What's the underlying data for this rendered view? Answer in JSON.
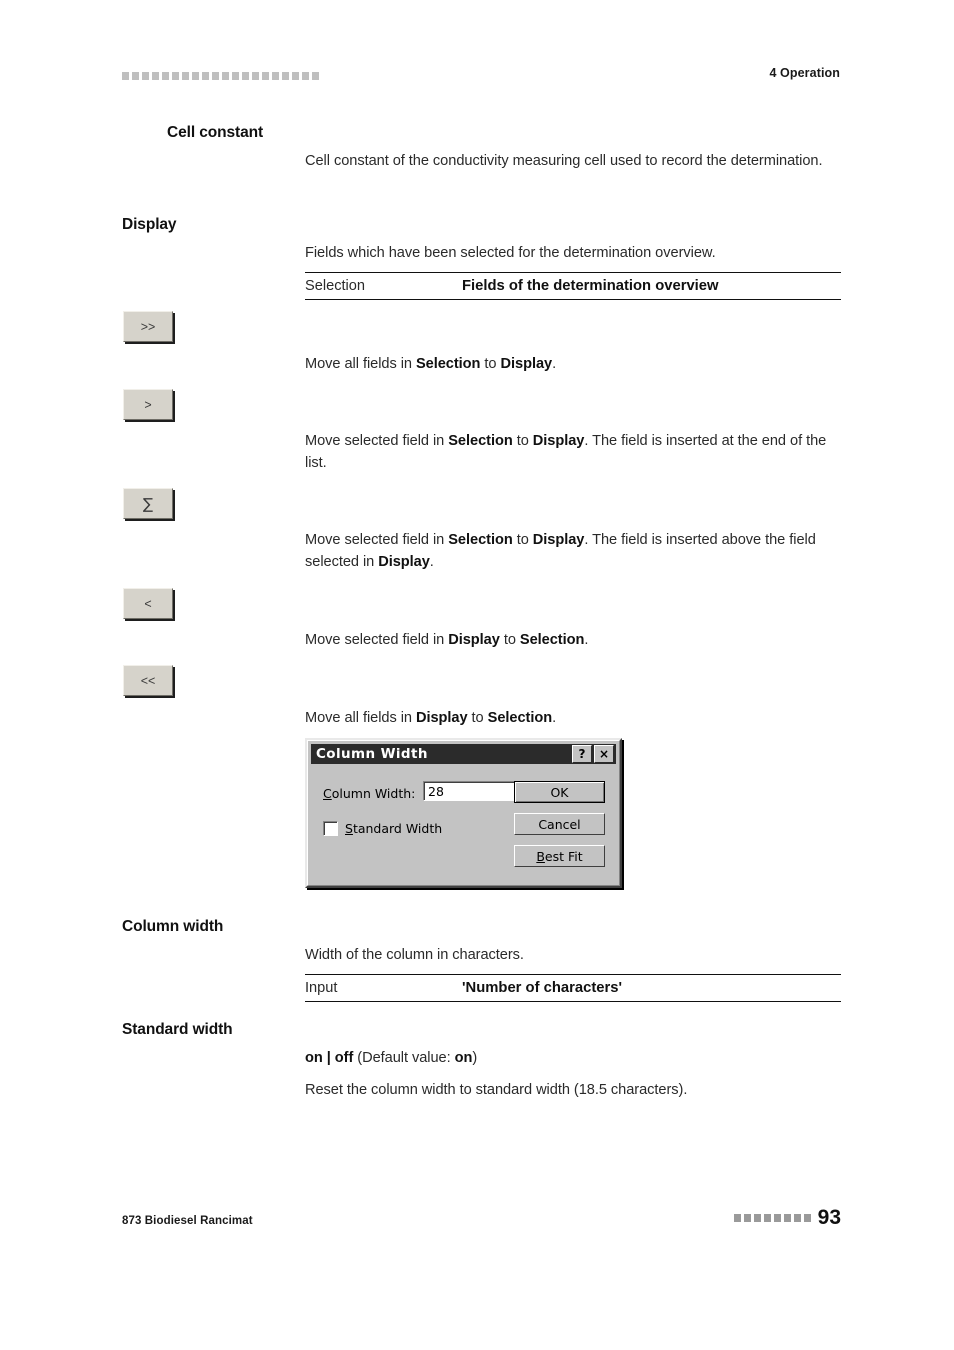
{
  "header": {
    "decoration_squares": 20,
    "section_title": "4 Operation"
  },
  "sections": [
    {
      "margin_heading": "Cell constant",
      "paragraph": "Cell constant of the conductivity measuring cell used to record the determination."
    },
    {
      "margin_heading": "Display",
      "paragraph": "Fields which have been selected for the determination overview."
    }
  ],
  "headings": {
    "cell_constant": "Cell constant",
    "display": "Display",
    "column_width": "Column width",
    "standard_width": "Standard width"
  },
  "paragraphs": {
    "cell_constant_desc": "Cell constant of the conductivity measuring cell used to record the determination.",
    "display_desc": "Fields which have been selected for the determination overview.",
    "column_width_desc": "Width of the column in characters.",
    "standard_width_desc": "Reset the column width to standard width (18.5 characters)."
  },
  "tables": {
    "display": {
      "key": "Selection",
      "value": "Fields of the determination overview"
    },
    "column_width": {
      "key": "Input",
      "value": "'Number of characters'"
    }
  },
  "buttons": [
    {
      "label": ">>",
      "icon": "double-chevron-right-icon",
      "description_prefix": "Move all fields in ",
      "description_b1": "Selection",
      "description_mid": " to ",
      "description_b2": "Display",
      "description_suffix": "."
    },
    {
      "label": ">",
      "icon": "chevron-right-icon",
      "description": "Move selected field in Selection to Display. The field is inserted at the end of the list."
    },
    {
      "label": "∑",
      "icon": "sigma-icon",
      "description": "Move selected field in Selection to Display. The field is inserted above the field selected in Display."
    },
    {
      "label": "<",
      "icon": "chevron-left-icon",
      "description": "Move selected field in Display to Selection."
    },
    {
      "label": "<<",
      "icon": "double-chevron-left-icon",
      "description": "Move all fields in Display to Selection."
    }
  ],
  "button_text": {
    "b1": {
      "pre": "Move all fields in ",
      "s1": "Selection",
      "mid": " to ",
      "s2": "Display",
      "post": "."
    },
    "b2": {
      "pre": "Move selected field in ",
      "s1": "Selection",
      "mid": " to ",
      "s2": "Display",
      "post": ". The field is inserted at the end of the list."
    },
    "b3": {
      "pre": "Move selected field in ",
      "s1": "Selection",
      "mid": " to ",
      "s2": "Display",
      "post": ". The field is inserted above the field selected in ",
      "s3": "Display",
      "post2": "."
    },
    "b4": {
      "pre": "Move selected field in ",
      "s1": "Display",
      "mid": " to ",
      "s2": "Selection",
      "post": "."
    },
    "b5": {
      "pre": "Move all fields in ",
      "s1": "Display",
      "mid": " to ",
      "s2": "Selection",
      "post": "."
    }
  },
  "dialog": {
    "title": "Column Width",
    "help_button": "?",
    "close_button": "×",
    "field_label_accel": "C",
    "field_label_rest": "olumn Width:",
    "field_value": "28",
    "checkbox_label_accel": "S",
    "checkbox_label_rest": "tandard Width",
    "checkbox_checked": false,
    "ok_label": "OK",
    "cancel_label": "Cancel",
    "bestfit_accel": "B",
    "bestfit_rest": "est Fit"
  },
  "standard_width_values": {
    "options": "on | off",
    "default_text": " (Default value: ",
    "default_value": "on",
    "default_close": ")"
  },
  "footer": {
    "document_title": "873 Biodiesel Rancimat",
    "page_number": "93",
    "decoration_squares": 8
  },
  "colors": {
    "page_background": "#ffffff",
    "text": "#2a2a2a",
    "heading": "#111111",
    "rule": "#111111",
    "decoration_square": "#bfbfbf",
    "dialog_face": "#c3c3c3",
    "dialog_titlebar": "#2b2b2b",
    "chip_face": "#d6d3cb"
  }
}
